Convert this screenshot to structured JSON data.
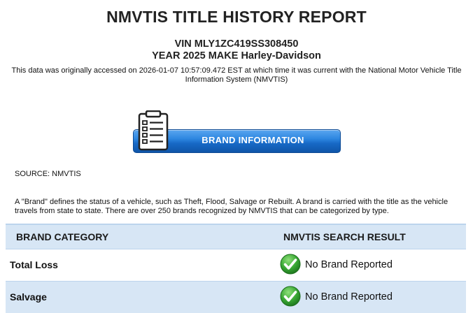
{
  "report": {
    "title": "NMVTIS TITLE HISTORY REPORT",
    "vin_line": "VIN MLY1ZC419SS308450",
    "vehicle_line": "YEAR 2025 MAKE Harley-Davidson",
    "access_note": "This data was originally accessed on 2026-01-07 10:57:09.472 EST at which time it was current with the National Motor Vehicle Title Information System (NMVTIS)"
  },
  "section": {
    "banner_label": "BRAND INFORMATION",
    "icon": "clipboard-checklist-icon",
    "source": "SOURCE: NMVTIS",
    "definition": "A \"Brand\" defines the status of a vehicle, such as Theft, Flood, Salvage or Rebuilt. A brand is carried with the title as the vehicle travels from state to state. There are over 250 brands recognized by NMVTIS that can be categorized by type."
  },
  "table": {
    "col_category": "BRAND CATEGORY",
    "col_result": "NMVTIS SEARCH RESULT",
    "rows": [
      {
        "category": "Total Loss",
        "result": "No Brand Reported",
        "icon": "green-check-icon"
      },
      {
        "category": "Salvage",
        "result": "No Brand Reported",
        "icon": "green-check-icon"
      }
    ]
  },
  "colors": {
    "banner": "#1e74d0",
    "table_header": "#d7e6f5",
    "check_green": "#3aa935"
  }
}
